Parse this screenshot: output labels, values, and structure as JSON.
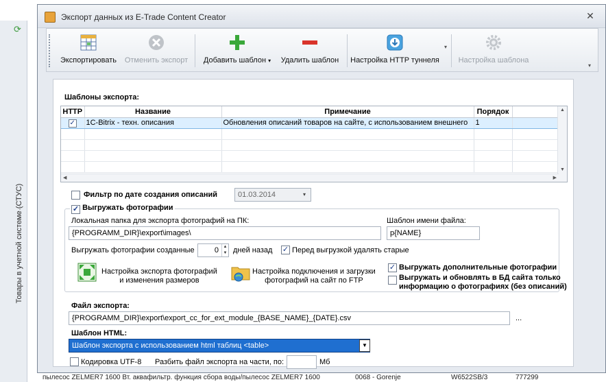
{
  "background": {
    "side_label": "Товары в учетной системе (СТУС)",
    "bottom_row": [
      "пылесос ZELMER7 1600 Вт. аквафильтр. функция сбора воды/пылесос ZELMER7 1600",
      "0068 - Gorenje",
      "W6522SB/3",
      "777299"
    ]
  },
  "window": {
    "title": "Экспорт данных из E-Trade Content Creator",
    "close": "✕"
  },
  "toolbar": {
    "export": "Экспортировать",
    "cancel_export": "Отменить экспорт",
    "add_template": "Добавить шаблон",
    "add_template_arrow": "▾",
    "remove_template": "Удалить шаблон",
    "http_tunnel": "Настройка HTTP туннеля",
    "http_tunnel_arrow": "▾",
    "template_settings": "Настройка шаблона",
    "overflow": "▾"
  },
  "templates": {
    "label": "Шаблоны экспорта:",
    "columns": [
      "HTTP",
      "Название",
      "Примечание",
      "Порядок"
    ],
    "rows": [
      {
        "http": "✓",
        "name": "1C-Bitrix - техн. описания",
        "note": "Обновления описаний товаров на сайте, с использованием внешнего",
        "order": "1"
      }
    ]
  },
  "filter": {
    "checked": "",
    "label": "Фильтр по дате создания описаний",
    "date": "01.03.2014",
    "arrow": "▾"
  },
  "photos": {
    "checked": "✓",
    "label": "Выгружать фотографии",
    "local_folder_label": "Локальная папка для экспорта фотографий на ПК:",
    "local_folder_value": "{PROGRAMM_DIR}\\export\\images\\",
    "filename_template_label": "Шаблон имени файла:",
    "filename_template_value": "p{NAME}",
    "created_label": "Выгружать фотографии созданные",
    "days_value": "0",
    "days_ago_label": "дней назад",
    "delete_old_checked": "✓",
    "delete_old_label": "Перед выгрузкой удалять старые",
    "resize_link": "Настройка экспорта фотографий\nи изменения размеров",
    "ftp_link": "Настройка подключения и загрузки\nфотографий на сайт по FTP",
    "extra_checked": "✓",
    "extra_label": "Выгружать дополнительные фотографии",
    "db_only_checked": "",
    "db_only_label": "Выгружать и обновлять в БД сайта только\nинформацию о фотографиях (без описаний)"
  },
  "export_file": {
    "label": "Файл экспорта:",
    "value": "{PROGRAMM_DIR}\\export\\export_cc_for_ext_module_{BASE_NAME}_{DATE}.csv",
    "browse": "..."
  },
  "html_template": {
    "label": "Шаблон HTML:",
    "value": "Шаблон экспорта с использованием html таблиц <table>",
    "arrow": "▼"
  },
  "bottom": {
    "utf8_checked": "",
    "utf8_label": "Кодировка UTF-8",
    "split_label": "Разбить файл экспорта на части, по:",
    "split_value": "",
    "unit": "Мб"
  },
  "colors": {
    "accent": "#1f6fd0",
    "selection": "#dcefff",
    "add_green": "#3aa83a",
    "remove_red": "#d9342b"
  }
}
